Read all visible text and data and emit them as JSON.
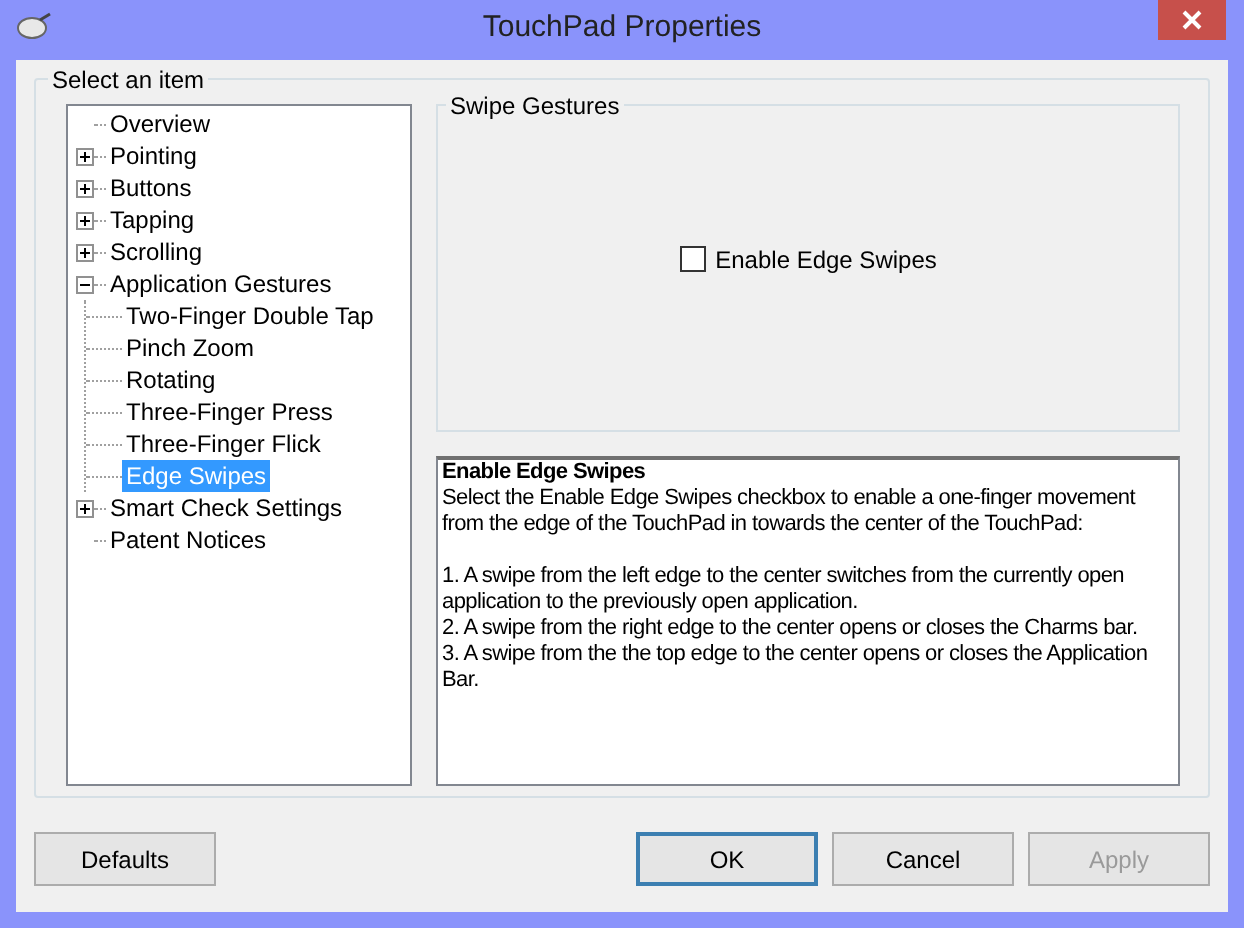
{
  "window": {
    "title": "TouchPad Properties"
  },
  "group_title": "Select an item",
  "tree": [
    {
      "label": "Overview",
      "selected": false
    },
    {
      "label": "Pointing",
      "selected": false,
      "expanded": false
    },
    {
      "label": "Buttons",
      "selected": false,
      "expanded": false
    },
    {
      "label": "Tapping",
      "selected": false,
      "expanded": false
    },
    {
      "label": "Scrolling",
      "selected": false,
      "expanded": false
    },
    {
      "label": "Application Gestures",
      "selected": false,
      "expanded": true,
      "children": [
        {
          "label": "Two-Finger Double Tap",
          "selected": false
        },
        {
          "label": "Pinch Zoom",
          "selected": false
        },
        {
          "label": "Rotating",
          "selected": false
        },
        {
          "label": "Three-Finger Press",
          "selected": false
        },
        {
          "label": "Three-Finger Flick",
          "selected": false
        },
        {
          "label": "Edge Swipes",
          "selected": true
        }
      ]
    },
    {
      "label": "Smart Check Settings",
      "selected": false,
      "expanded": false
    },
    {
      "label": "Patent Notices",
      "selected": false
    }
  ],
  "settings": {
    "title": "Swipe Gestures",
    "checkbox": {
      "label": "Enable Edge Swipes",
      "checked": false
    }
  },
  "description": {
    "title": "Enable Edge Swipes",
    "paragraphs": [
      "Select the Enable Edge Swipes checkbox to enable a one-finger movement from the edge of the TouchPad in towards the center of the TouchPad:",
      "1. A swipe from the left edge to the center switches from the currently open application to the previously open application.",
      "2. A swipe from the right edge to the center opens or closes the Charms bar.",
      "3. A swipe from the the top edge to the center opens or closes the Application Bar."
    ]
  },
  "buttons": [
    {
      "label": "Defaults",
      "disabled": false,
      "default": false
    },
    {
      "label": "OK",
      "disabled": false,
      "default": true
    },
    {
      "label": "Cancel",
      "disabled": false,
      "default": false
    },
    {
      "label": "Apply",
      "disabled": true,
      "default": false
    }
  ]
}
